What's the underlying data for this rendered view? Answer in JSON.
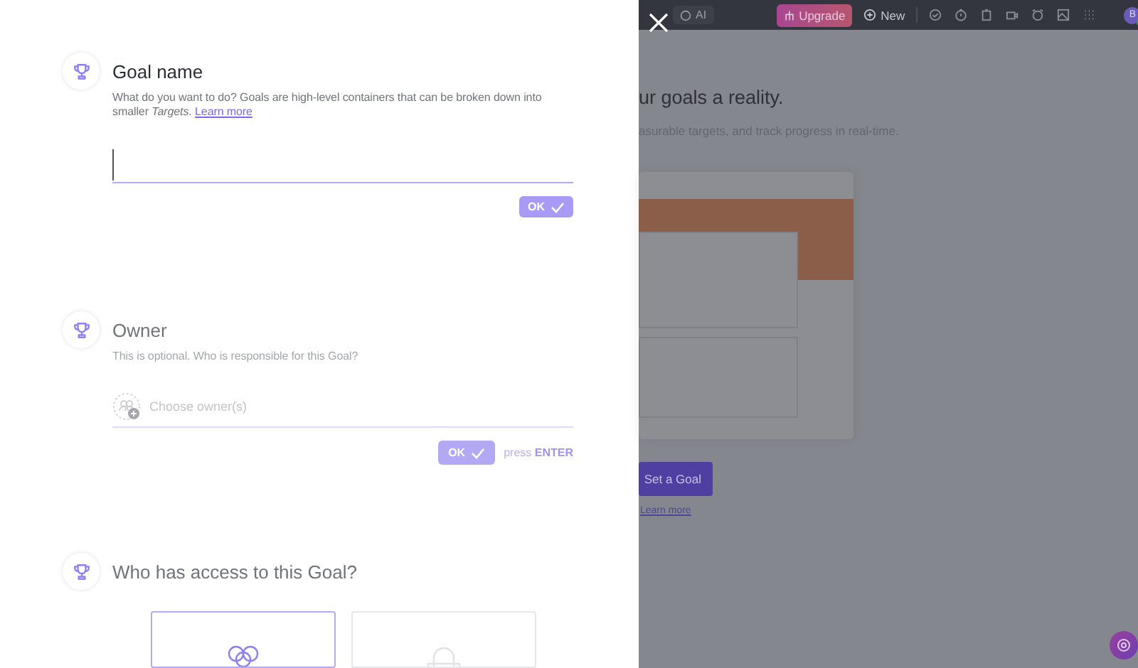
{
  "modal": {
    "sections": [
      {
        "kind": "name",
        "active": true,
        "title": "Goal name",
        "description": "What do you want to do? Goals are high-level containers that can be broken down into smaller *Targets*.",
        "link": "Learn more",
        "button": "OK"
      },
      {
        "kind": "owner",
        "active": false,
        "title": "Owner",
        "description": "This is optional. Who is responsible for this Goal?",
        "placeholder": "Choose owner(s)",
        "button": "OK",
        "hint": "press **ENTER**"
      },
      {
        "kind": "access",
        "active": false,
        "title": "Who has access to this Goal?",
        "options": [
          {
            "kind": "team",
            "selected": true
          },
          {
            "kind": "private",
            "selected": false
          }
        ]
      }
    ]
  },
  "topbar": {
    "ai": "AI",
    "upgrade": "Upgrade",
    "new": "New",
    "avatar": "B"
  },
  "page": {
    "heading": "ur goals a reality.",
    "subtitle": "asurable targets, and track progress in real-time.",
    "button": "Set a Goal",
    "link": "Learn more"
  }
}
